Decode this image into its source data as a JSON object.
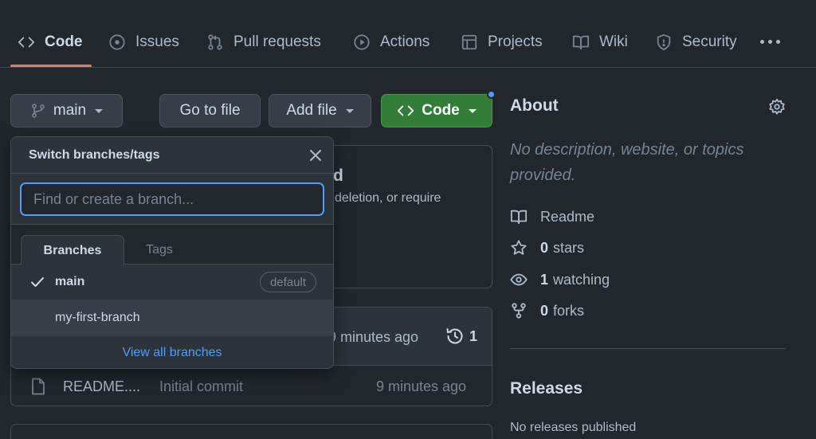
{
  "nav": {
    "tabs": [
      {
        "label": "Code",
        "icon": "code-icon",
        "active": true
      },
      {
        "label": "Issues",
        "icon": "issue-opened-icon"
      },
      {
        "label": "Pull requests",
        "icon": "git-pull-request-icon"
      },
      {
        "label": "Actions",
        "icon": "play-icon"
      },
      {
        "label": "Projects",
        "icon": "table-icon"
      },
      {
        "label": "Wiki",
        "icon": "book-icon"
      },
      {
        "label": "Security",
        "icon": "shield-icon"
      }
    ],
    "active_underline_color": "#ec775c"
  },
  "toolbar": {
    "branch_label": "main",
    "go_to_file": "Go to file",
    "add_file": "Add file",
    "code_button": "Code"
  },
  "branch_menu": {
    "title": "Switch branches/tags",
    "search_placeholder": "Find or create a branch...",
    "tabs": {
      "branches": "Branches",
      "tags": "Tags"
    },
    "branches": [
      {
        "name": "main",
        "selected": true,
        "badge": "default"
      },
      {
        "name": "my-first-branch",
        "selected": false
      }
    ],
    "view_all": "View all branches"
  },
  "background": {
    "partial_heading": "d",
    "partial_text": "deletion, or require",
    "commit_time_partial": "9 minutes ago",
    "commit_count": "1",
    "file": {
      "name": "README....",
      "message": "Initial commit",
      "time": "9 minutes ago"
    }
  },
  "about": {
    "title": "About",
    "description": "No description, website, or topics provided.",
    "readme": "Readme",
    "stars_count": "0",
    "stars_label": "stars",
    "watching_count": "1",
    "watching_label": "watching",
    "forks_count": "0",
    "forks_label": "forks"
  },
  "releases": {
    "title": "Releases",
    "empty": "No releases published"
  },
  "colors": {
    "background": "#22272e",
    "primary_button": "#347d39",
    "link": "#539bf5"
  }
}
